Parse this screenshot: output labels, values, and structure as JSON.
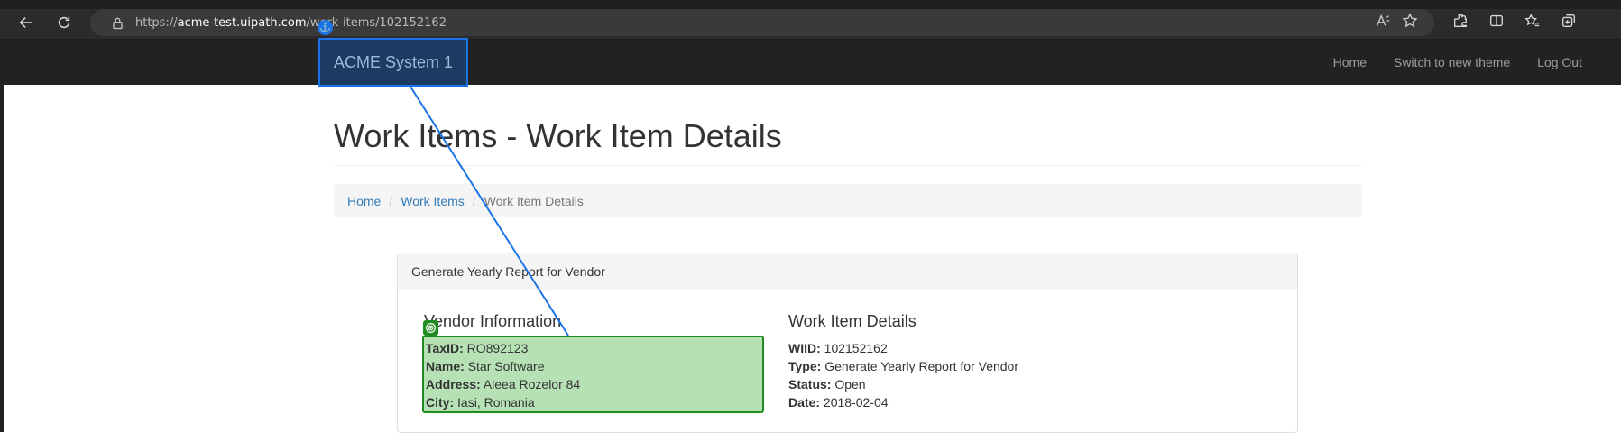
{
  "browser": {
    "url_prefix": "https://",
    "url_host": "acme-test.uipath.com",
    "url_path": "/work-items/102152162"
  },
  "navbar": {
    "brand": "ACME System 1",
    "links": [
      "Home",
      "Switch to new theme",
      "Log Out"
    ]
  },
  "page": {
    "title": "Work Items - Work Item Details",
    "breadcrumb": [
      "Home",
      "Work Items",
      "Work Item Details"
    ]
  },
  "panel": {
    "heading": "Generate Yearly Report for Vendor",
    "vendor": {
      "title": "Vendor Information",
      "fields": [
        {
          "label": "TaxID:",
          "value": "RO892123"
        },
        {
          "label": "Name:",
          "value": "Star Software"
        },
        {
          "label": "Address:",
          "value": "Aleea Rozelor 84"
        },
        {
          "label": "City:",
          "value": "Iasi, Romania"
        }
      ]
    },
    "work_item": {
      "title": "Work Item Details",
      "fields": [
        {
          "label": "WIID:",
          "value": "102152162"
        },
        {
          "label": "Type:",
          "value": "Generate Yearly Report for Vendor"
        },
        {
          "label": "Status:",
          "value": "Open"
        },
        {
          "label": "Date:",
          "value": "2018-02-04"
        }
      ]
    }
  },
  "colors": {
    "anchor": "#1a73e8",
    "target": "#1e8c1e",
    "navbar": "#222222",
    "link": "#337ab7"
  }
}
